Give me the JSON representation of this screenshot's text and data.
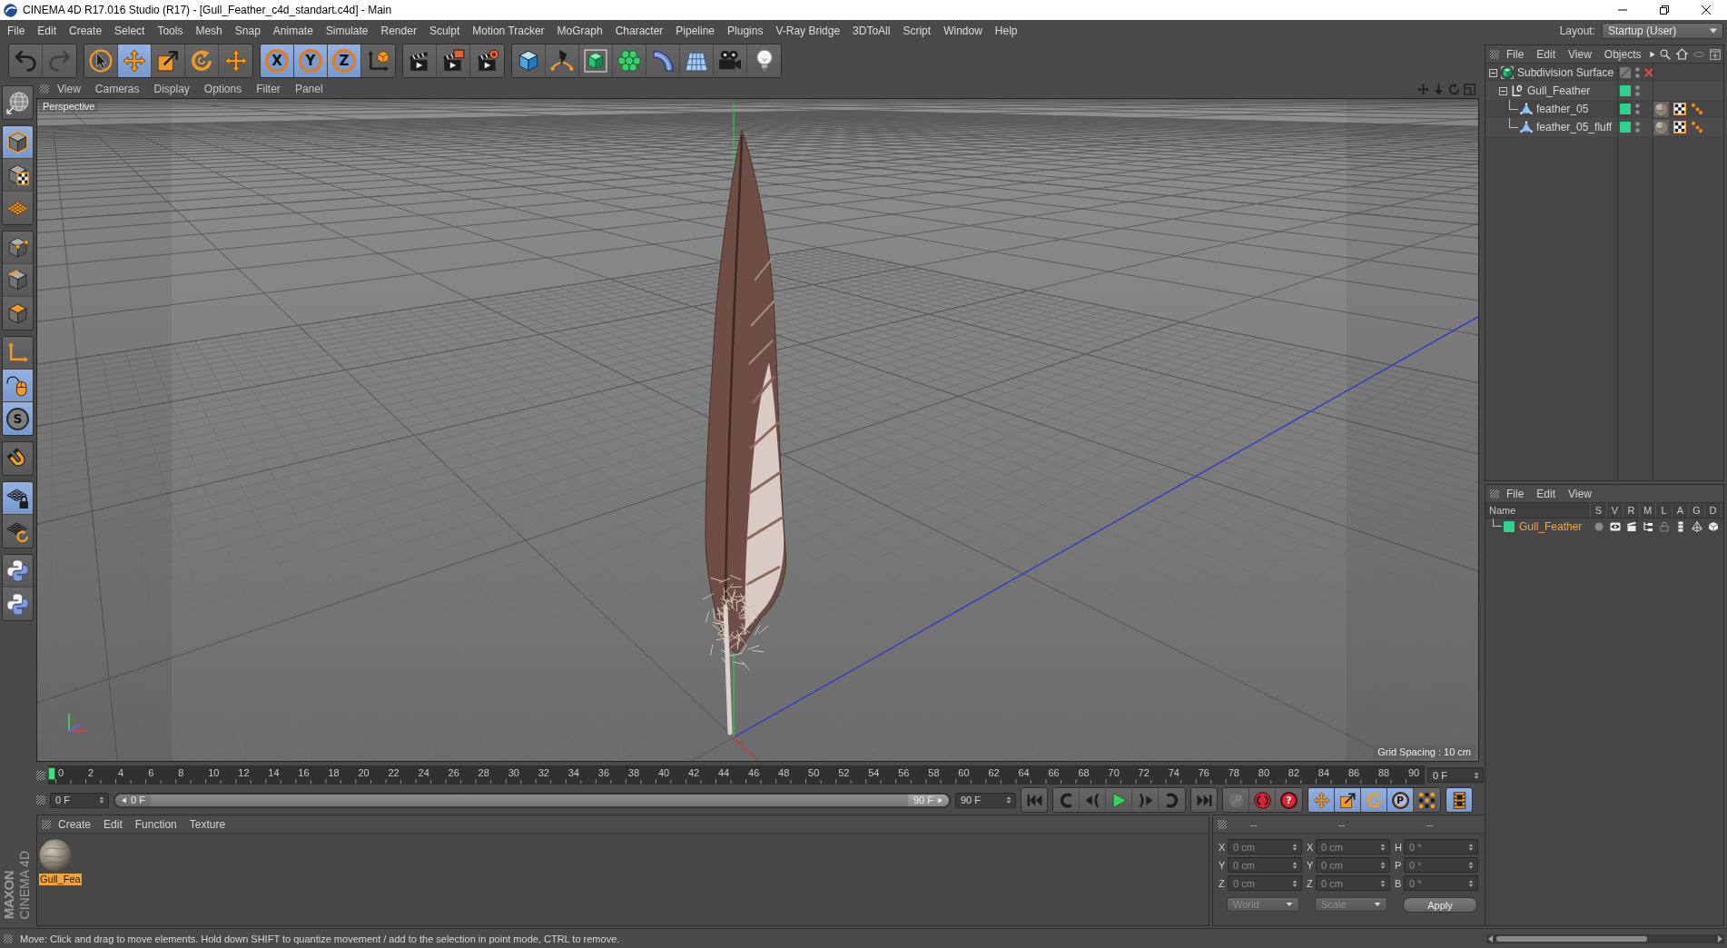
{
  "window": {
    "title": "CINEMA 4D R17.016 Studio (R17) - [Gull_Feather_c4d_standart.c4d] - Main"
  },
  "menu_bar": [
    "File",
    "Edit",
    "Create",
    "Select",
    "Tools",
    "Mesh",
    "Snap",
    "Animate",
    "Simulate",
    "Render",
    "Sculpt",
    "Motion Tracker",
    "MoGraph",
    "Character",
    "Pipeline",
    "Plugins",
    "V-Ray Bridge",
    "3DToAll",
    "Script",
    "Window",
    "Help"
  ],
  "layout": {
    "label": "Layout:",
    "value": "Startup (User)"
  },
  "toolbar": [
    {
      "buttons": [
        {
          "kind": "undo",
          "selected": false,
          "disabled": false
        },
        {
          "kind": "redo",
          "selected": false,
          "disabled": true
        }
      ]
    },
    {
      "buttons": [
        {
          "kind": "live_select",
          "selected": false
        },
        {
          "kind": "move",
          "selected": true
        },
        {
          "kind": "scale",
          "selected": false
        },
        {
          "kind": "rotate",
          "selected": false
        },
        {
          "kind": "last_tool",
          "selected": false
        }
      ]
    },
    {
      "buttons": [
        {
          "kind": "axis_letter",
          "label": "X",
          "selected": true
        },
        {
          "kind": "axis_letter",
          "label": "Y",
          "selected": true
        },
        {
          "kind": "axis_letter",
          "label": "Z",
          "selected": true
        },
        {
          "kind": "coord_system",
          "selected": false
        }
      ]
    },
    {
      "buttons": [
        {
          "kind": "render_view",
          "selected": false
        },
        {
          "kind": "render_viewer",
          "selected": false
        },
        {
          "kind": "render_settings",
          "selected": false
        }
      ]
    },
    {
      "buttons": [
        {
          "kind": "cube",
          "selected": false
        },
        {
          "kind": "pen",
          "selected": false
        },
        {
          "kind": "subdivision",
          "selected": false
        },
        {
          "kind": "cloner",
          "selected": false
        },
        {
          "kind": "deformer",
          "selected": false
        },
        {
          "kind": "floor",
          "selected": false
        },
        {
          "kind": "camera",
          "selected": false
        },
        {
          "kind": "light",
          "selected": false
        }
      ]
    }
  ],
  "palette": [
    {
      "buttons": [
        {
          "kind": "make_editable",
          "selected": false
        }
      ]
    },
    {
      "buttons": [
        {
          "kind": "model",
          "selected": true
        },
        {
          "kind": "texture",
          "selected": false
        },
        {
          "kind": "workplane",
          "selected": false
        }
      ]
    },
    {
      "buttons": [
        {
          "kind": "points",
          "selected": false
        },
        {
          "kind": "edges",
          "selected": false
        },
        {
          "kind": "polygons",
          "selected": false
        }
      ]
    },
    {
      "buttons": [
        {
          "kind": "axis",
          "selected": false
        },
        {
          "kind": "tweak",
          "selected": true
        },
        {
          "kind": "snap_letter",
          "label": "S",
          "selected": true
        }
      ]
    },
    {
      "buttons": [
        {
          "kind": "magnet",
          "selected": false
        }
      ]
    },
    {
      "buttons": [
        {
          "kind": "lock_workplane",
          "selected": true
        },
        {
          "kind": "workplane_rotate",
          "selected": false
        }
      ]
    },
    {
      "buttons": [
        {
          "kind": "python",
          "selected": false
        },
        {
          "kind": "python",
          "selected": false
        }
      ]
    }
  ],
  "viewport": {
    "menu": [
      "View",
      "Cameras",
      "Display",
      "Options",
      "Filter",
      "Panel"
    ],
    "camera": "Perspective",
    "grid_spacing": "Grid Spacing : 10 cm"
  },
  "timeline": {
    "ticks": [
      "0",
      "2",
      "4",
      "6",
      "8",
      "10",
      "12",
      "14",
      "16",
      "18",
      "20",
      "22",
      "24",
      "26",
      "28",
      "30",
      "32",
      "34",
      "36",
      "38",
      "40",
      "42",
      "44",
      "46",
      "48",
      "50",
      "52",
      "54",
      "56",
      "58",
      "60",
      "62",
      "64",
      "66",
      "68",
      "70",
      "72",
      "74",
      "76",
      "78",
      "80",
      "82",
      "84",
      "86",
      "88",
      "90"
    ],
    "level": 0,
    "current_frame": "0 F"
  },
  "transport": {
    "start": "0 F",
    "range": {
      "start_label": "0 F",
      "end_label": "90 F",
      "level": 1
    },
    "end": "90 F",
    "groups": [
      {
        "buttons": [
          {
            "kind": "go_start"
          }
        ]
      },
      {
        "buttons": [
          {
            "kind": "prev_key"
          },
          {
            "kind": "prev_frame"
          },
          {
            "kind": "play"
          },
          {
            "kind": "next_frame"
          },
          {
            "kind": "next_key"
          }
        ]
      },
      {
        "buttons": [
          {
            "kind": "go_end"
          }
        ]
      },
      {
        "buttons": [
          {
            "kind": "autokey",
            "disabled": true
          },
          {
            "kind": "record",
            "disabled": false
          },
          {
            "kind": "help_letter",
            "label": "?",
            "disabled": false
          }
        ]
      },
      {
        "buttons": [
          {
            "kind": "move",
            "selected": true
          },
          {
            "kind": "scale",
            "selected": true
          },
          {
            "kind": "rotate",
            "selected": true
          },
          {
            "kind": "param_letter",
            "label": "P",
            "selected": true
          },
          {
            "kind": "point_level",
            "selected": false
          }
        ]
      },
      {
        "buttons": [
          {
            "kind": "timeline",
            "selected": true
          }
        ]
      }
    ]
  },
  "materials": {
    "menu": [
      "Create",
      "Edit",
      "Function",
      "Texture"
    ],
    "items": [
      {
        "name": "Gull_Fea",
        "selected": true
      }
    ]
  },
  "coordinates": {
    "headers": [
      "--",
      "--",
      "--"
    ],
    "disabled": true,
    "rows": [
      {
        "cells": [
          {
            "axis": "X",
            "value": "0 cm"
          },
          {
            "axis": "X",
            "value": "0 cm"
          },
          {
            "axis": "H",
            "value": "0 °"
          }
        ]
      },
      {
        "cells": [
          {
            "axis": "Y",
            "value": "0 cm"
          },
          {
            "axis": "Y",
            "value": "0 cm"
          },
          {
            "axis": "P",
            "value": "0 °"
          }
        ]
      },
      {
        "cells": [
          {
            "axis": "Z",
            "value": "0 cm"
          },
          {
            "axis": "Z",
            "value": "0 cm"
          },
          {
            "axis": "B",
            "value": "0 °"
          }
        ]
      }
    ],
    "mode": "World",
    "transform": "Scale",
    "action": "Apply"
  },
  "object_manager": {
    "menu": [
      "File",
      "Edit",
      "View",
      "Objects"
    ],
    "objects": [
      {
        "name": "Subdivision Surface",
        "kind": "generator",
        "expanded": true,
        "enabled": false,
        "children": [
          {
            "name": "Gull_Feather",
            "kind": "null",
            "expanded": true,
            "color": "#2fd18e",
            "children": [
              {
                "name": "feather_05",
                "kind": "polygon",
                "color": "#2fd18e",
                "tags": [
                  {
                    "kind": "material"
                  },
                  {
                    "kind": "uvw"
                  },
                  {
                    "kind": "selection"
                  }
                ]
              },
              {
                "name": "feather_05_fluff",
                "kind": "polygon",
                "color": "#2fd18e",
                "tags": [
                  {
                    "kind": "material"
                  },
                  {
                    "kind": "uvw"
                  },
                  {
                    "kind": "selection"
                  }
                ]
              }
            ]
          }
        ]
      }
    ]
  },
  "layer_manager": {
    "menu": [
      "File",
      "Edit",
      "View"
    ],
    "columns": [
      "Name",
      "S",
      "V",
      "R",
      "M",
      "L",
      "A",
      "G",
      "D"
    ],
    "layers": [
      {
        "name": "Gull_Feather",
        "color": "#2fd18e",
        "selected": true,
        "flags": [
          {
            "kind": "solo",
            "on": false
          },
          {
            "kind": "view",
            "on": true
          },
          {
            "kind": "render",
            "on": true
          },
          {
            "kind": "manager",
            "on": true
          },
          {
            "kind": "locked",
            "on": false
          },
          {
            "kind": "animation",
            "on": true
          },
          {
            "kind": "generators",
            "on": true
          },
          {
            "kind": "deformers",
            "on": true
          }
        ]
      }
    ]
  },
  "logo": {
    "brand": "MAXON",
    "product": "CINEMA 4D"
  },
  "status_bar": {
    "text": "Move: Click and drag to move elements. Hold down SHIFT to quantize movement / add to the selection in point mode, CTRL to remove."
  }
}
